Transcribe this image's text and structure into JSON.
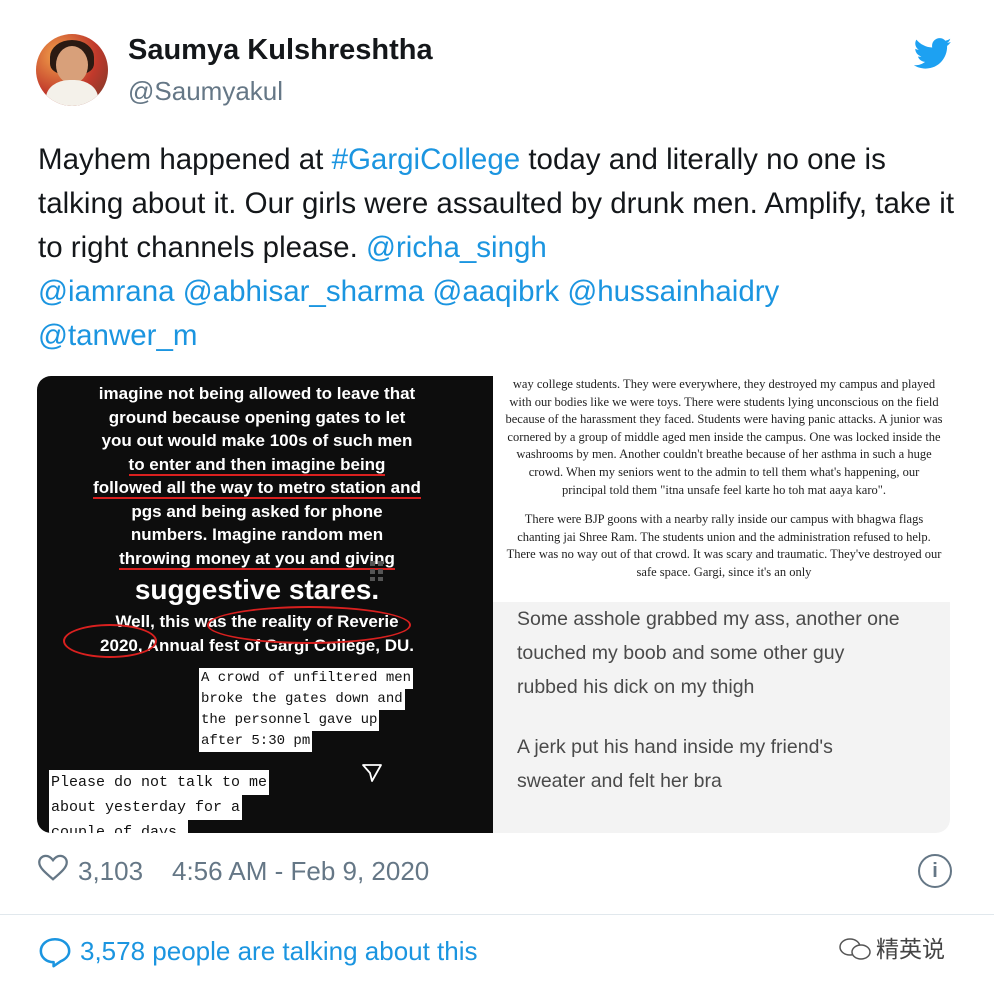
{
  "author": {
    "name": "Saumya Kulshreshtha",
    "handle": "@Saumyakul"
  },
  "tweet": {
    "text_prefix": "Mayhem happened at ",
    "hashtag": "#GargiCollege",
    "text_mid1": " today and literally no one is talking about it. Our girls were assaulted by drunk men. Amplify, take it to right channels please. ",
    "mention1": "@richa_singh",
    "mention2": "@iamrana",
    "mention3": "@abhisar_sharma",
    "mention4": "@aaqibrk",
    "mention5": "@hussainhaidry",
    "mention6": "@tanwer_m"
  },
  "media": {
    "left": {
      "line1": "imagine not being allowed to leave that",
      "line2": "ground because opening gates to let",
      "line3": "you out would make 100s of such men",
      "line4": "to enter and then imagine being",
      "line5": "followed all the way to metro station and",
      "line6": "pgs and being asked for phone",
      "line7": "numbers. Imagine random men",
      "line8": "throwing money at you and giving",
      "line9": "suggestive stares.",
      "line10": "Well, this was the reality of Reverie",
      "line11": "2020, Annual fest of Gargi College, DU.",
      "tw1": "A crowd of unfiltered men",
      "tw2": "broke the gates down and",
      "tw3": "the personnel gave up",
      "tw4": "after 5:30 pm",
      "tw5": "Please do not talk to me",
      "tw6": "about yesterday for a",
      "tw7": "couple of days."
    },
    "doc": {
      "p1": "way college students. They were everywhere, they destroyed my campus and played with our bodies like we were toys. There were students lying unconscious on the field because of the harassment they faced. Students were having panic attacks. A junior was cornered by a group of middle aged men inside the campus. One was locked inside the washrooms by men. Another couldn't breathe because of her asthma in such a huge crowd.  When my seniors went to the admin to tell them what's happening, our principal told them \"itna unsafe feel karte ho toh mat aaya karo\".",
      "p2": "There were BJP goons with a nearby rally inside our campus with bhagwa flags chanting jai Shree Ram. The students union and the administration refused to help. There was no way out of that crowd. It was scary and traumatic. They've destroyed our safe space. Gargi, since it's an only"
    },
    "chat": {
      "c1": "Some asshole grabbed my ass, another one",
      "c2": "touched my boob and some other guy",
      "c3": "rubbed his dick on my thigh",
      "c4": "A jerk put his hand inside my friend's",
      "c5": "sweater and felt her bra"
    }
  },
  "footer": {
    "likes": "3,103",
    "timestamp": "4:56 AM - Feb 9, 2020",
    "info": "i",
    "talking": "3,578 people are talking about this"
  },
  "watermark": "精英说",
  "colors": {
    "link": "#1b95e0",
    "meta": "#657786",
    "twitter": "#1da1f2",
    "red_marker": "#d9201f"
  }
}
